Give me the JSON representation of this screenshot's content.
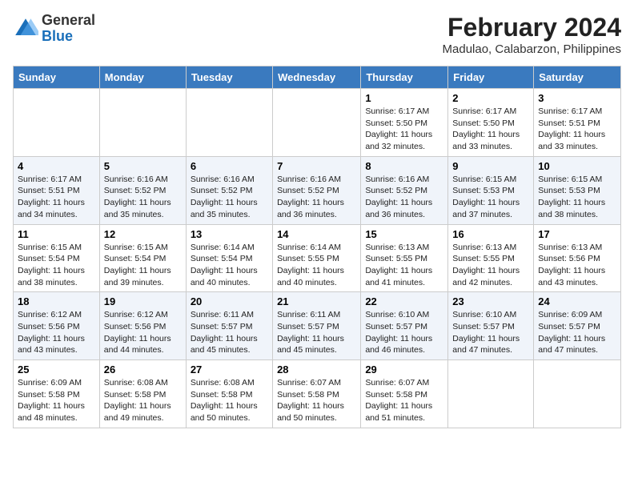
{
  "header": {
    "logo_general": "General",
    "logo_blue": "Blue",
    "title": "February 2024",
    "subtitle": "Madulao, Calabarzon, Philippines"
  },
  "columns": [
    "Sunday",
    "Monday",
    "Tuesday",
    "Wednesday",
    "Thursday",
    "Friday",
    "Saturday"
  ],
  "weeks": [
    [
      {
        "num": "",
        "info": ""
      },
      {
        "num": "",
        "info": ""
      },
      {
        "num": "",
        "info": ""
      },
      {
        "num": "",
        "info": ""
      },
      {
        "num": "1",
        "info": "Sunrise: 6:17 AM\nSunset: 5:50 PM\nDaylight: 11 hours\nand 32 minutes."
      },
      {
        "num": "2",
        "info": "Sunrise: 6:17 AM\nSunset: 5:50 PM\nDaylight: 11 hours\nand 33 minutes."
      },
      {
        "num": "3",
        "info": "Sunrise: 6:17 AM\nSunset: 5:51 PM\nDaylight: 11 hours\nand 33 minutes."
      }
    ],
    [
      {
        "num": "4",
        "info": "Sunrise: 6:17 AM\nSunset: 5:51 PM\nDaylight: 11 hours\nand 34 minutes."
      },
      {
        "num": "5",
        "info": "Sunrise: 6:16 AM\nSunset: 5:52 PM\nDaylight: 11 hours\nand 35 minutes."
      },
      {
        "num": "6",
        "info": "Sunrise: 6:16 AM\nSunset: 5:52 PM\nDaylight: 11 hours\nand 35 minutes."
      },
      {
        "num": "7",
        "info": "Sunrise: 6:16 AM\nSunset: 5:52 PM\nDaylight: 11 hours\nand 36 minutes."
      },
      {
        "num": "8",
        "info": "Sunrise: 6:16 AM\nSunset: 5:52 PM\nDaylight: 11 hours\nand 36 minutes."
      },
      {
        "num": "9",
        "info": "Sunrise: 6:15 AM\nSunset: 5:53 PM\nDaylight: 11 hours\nand 37 minutes."
      },
      {
        "num": "10",
        "info": "Sunrise: 6:15 AM\nSunset: 5:53 PM\nDaylight: 11 hours\nand 38 minutes."
      }
    ],
    [
      {
        "num": "11",
        "info": "Sunrise: 6:15 AM\nSunset: 5:54 PM\nDaylight: 11 hours\nand 38 minutes."
      },
      {
        "num": "12",
        "info": "Sunrise: 6:15 AM\nSunset: 5:54 PM\nDaylight: 11 hours\nand 39 minutes."
      },
      {
        "num": "13",
        "info": "Sunrise: 6:14 AM\nSunset: 5:54 PM\nDaylight: 11 hours\nand 40 minutes."
      },
      {
        "num": "14",
        "info": "Sunrise: 6:14 AM\nSunset: 5:55 PM\nDaylight: 11 hours\nand 40 minutes."
      },
      {
        "num": "15",
        "info": "Sunrise: 6:13 AM\nSunset: 5:55 PM\nDaylight: 11 hours\nand 41 minutes."
      },
      {
        "num": "16",
        "info": "Sunrise: 6:13 AM\nSunset: 5:55 PM\nDaylight: 11 hours\nand 42 minutes."
      },
      {
        "num": "17",
        "info": "Sunrise: 6:13 AM\nSunset: 5:56 PM\nDaylight: 11 hours\nand 43 minutes."
      }
    ],
    [
      {
        "num": "18",
        "info": "Sunrise: 6:12 AM\nSunset: 5:56 PM\nDaylight: 11 hours\nand 43 minutes."
      },
      {
        "num": "19",
        "info": "Sunrise: 6:12 AM\nSunset: 5:56 PM\nDaylight: 11 hours\nand 44 minutes."
      },
      {
        "num": "20",
        "info": "Sunrise: 6:11 AM\nSunset: 5:57 PM\nDaylight: 11 hours\nand 45 minutes."
      },
      {
        "num": "21",
        "info": "Sunrise: 6:11 AM\nSunset: 5:57 PM\nDaylight: 11 hours\nand 45 minutes."
      },
      {
        "num": "22",
        "info": "Sunrise: 6:10 AM\nSunset: 5:57 PM\nDaylight: 11 hours\nand 46 minutes."
      },
      {
        "num": "23",
        "info": "Sunrise: 6:10 AM\nSunset: 5:57 PM\nDaylight: 11 hours\nand 47 minutes."
      },
      {
        "num": "24",
        "info": "Sunrise: 6:09 AM\nSunset: 5:57 PM\nDaylight: 11 hours\nand 47 minutes."
      }
    ],
    [
      {
        "num": "25",
        "info": "Sunrise: 6:09 AM\nSunset: 5:58 PM\nDaylight: 11 hours\nand 48 minutes."
      },
      {
        "num": "26",
        "info": "Sunrise: 6:08 AM\nSunset: 5:58 PM\nDaylight: 11 hours\nand 49 minutes."
      },
      {
        "num": "27",
        "info": "Sunrise: 6:08 AM\nSunset: 5:58 PM\nDaylight: 11 hours\nand 50 minutes."
      },
      {
        "num": "28",
        "info": "Sunrise: 6:07 AM\nSunset: 5:58 PM\nDaylight: 11 hours\nand 50 minutes."
      },
      {
        "num": "29",
        "info": "Sunrise: 6:07 AM\nSunset: 5:58 PM\nDaylight: 11 hours\nand 51 minutes."
      },
      {
        "num": "",
        "info": ""
      },
      {
        "num": "",
        "info": ""
      }
    ]
  ]
}
